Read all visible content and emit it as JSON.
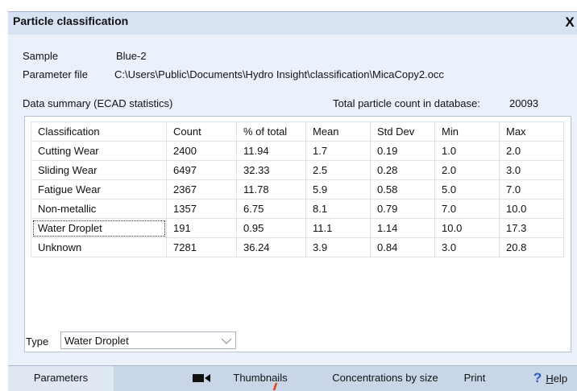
{
  "window": {
    "title": "Particle classification",
    "close_label": "X"
  },
  "info": {
    "sample_label": "Sample",
    "sample_value": "Blue-2",
    "param_label": "Parameter file",
    "param_value": "C:\\Users\\Public\\Documents\\Hydro Insight\\classification\\MicaCopy2.occ",
    "summary_label": "Data summary  (ECAD statistics)",
    "total_label": "Total particle count in database:",
    "total_value": "20093"
  },
  "table": {
    "headers": [
      "Classification",
      "Count",
      "% of total",
      "Mean",
      "Std Dev",
      "Min",
      "Max"
    ],
    "rows": [
      [
        "Cutting Wear",
        "2400",
        "11.94",
        "1.7",
        "0.19",
        "1.0",
        "2.0"
      ],
      [
        "Sliding Wear",
        "6497",
        "32.33",
        "2.5",
        "0.28",
        "2.0",
        "3.0"
      ],
      [
        "Fatigue Wear",
        "2367",
        "11.78",
        "5.9",
        "0.58",
        "5.0",
        "7.0"
      ],
      [
        "Non-metallic",
        "1357",
        "6.75",
        "8.1",
        "0.79",
        "7.0",
        "10.0"
      ],
      [
        "Water Droplet",
        "191",
        "0.95",
        "11.1",
        "1.14",
        "10.0",
        "17.3"
      ],
      [
        "Unknown",
        "7281",
        "36.24",
        "3.9",
        "0.84",
        "3.0",
        "20.8"
      ]
    ],
    "focused_row": 4
  },
  "type": {
    "label": "Type",
    "selected": "Water Droplet"
  },
  "bottom": {
    "parameters": "Parameters",
    "thumbnails": "Thumbnails",
    "concentrations": "Concentrations by size",
    "print": "Print",
    "help_mark": "?",
    "help_underlined": "H",
    "help_rest": "elp"
  },
  "colors": {
    "panel_bg": "#eaf1fb",
    "bottom_bar": "#c9d6e8",
    "help_icon": "#2a5fbf",
    "pointer_arrow": "#e0401a"
  }
}
